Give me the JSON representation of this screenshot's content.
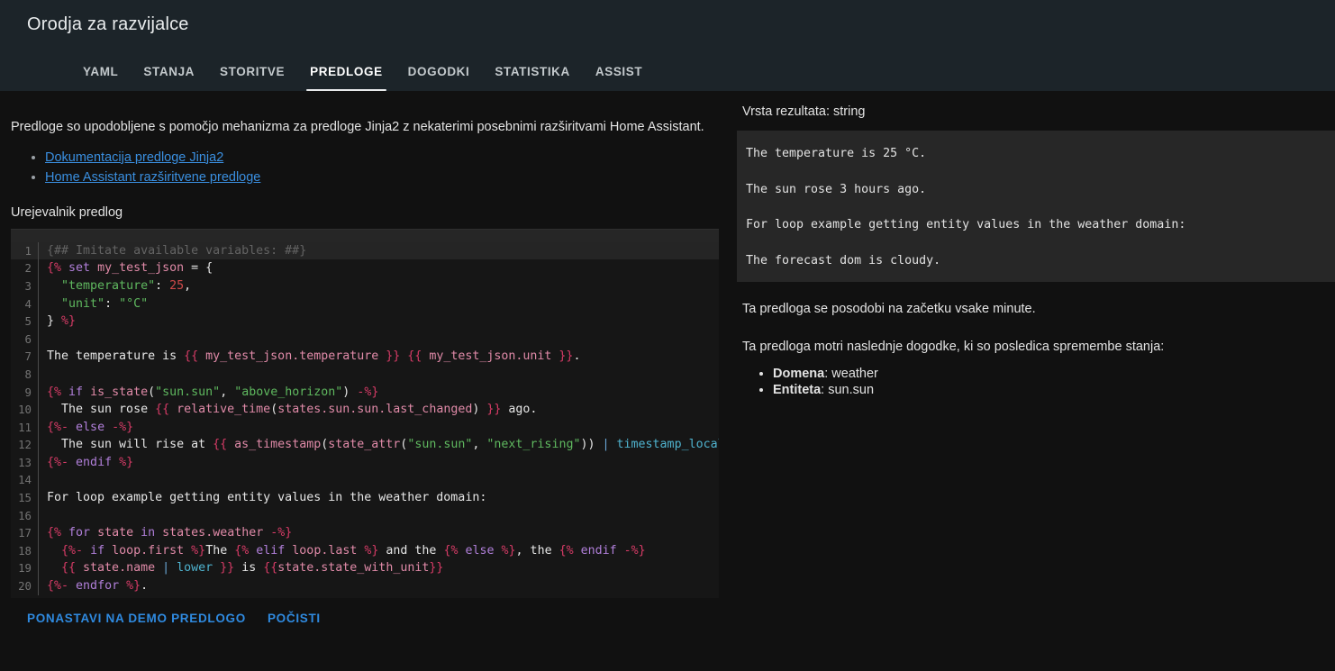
{
  "header": {
    "title": "Orodja za razvijalce",
    "tabs": [
      {
        "label": "YAML",
        "active": false
      },
      {
        "label": "STANJA",
        "active": false
      },
      {
        "label": "STORITVE",
        "active": false
      },
      {
        "label": "PREDLOGE",
        "active": true
      },
      {
        "label": "DOGODKI",
        "active": false
      },
      {
        "label": "STATISTIKA",
        "active": false
      },
      {
        "label": "ASSIST",
        "active": false
      }
    ]
  },
  "left": {
    "intro": "Predloge so upodobljene s pomočjo mehanizma za predloge Jinja2 z nekaterimi posebnimi razširitvami Home Assistant.",
    "links": [
      "Dokumentacija predloge Jinja2",
      "Home Assistant razširitvene predloge"
    ],
    "editor_label": "Urejevalnik predlog",
    "buttons": {
      "reset": "PONASTAVI NA DEMO PREDLOGO",
      "clear": "POČISTI"
    }
  },
  "editor": {
    "lines": [
      {
        "n": "1",
        "highlight": true,
        "tokens": [
          {
            "c": "t-comment",
            "t": "{## Imitate available variables: ##}"
          }
        ]
      },
      {
        "n": "2",
        "highlight": false,
        "tokens": [
          {
            "c": "t-delim",
            "t": "{%"
          },
          {
            "c": "t-plain",
            "t": " "
          },
          {
            "c": "t-kw",
            "t": "set"
          },
          {
            "c": "t-plain",
            "t": " "
          },
          {
            "c": "t-var",
            "t": "my_test_json"
          },
          {
            "c": "t-plain",
            "t": " = {"
          }
        ]
      },
      {
        "n": "3",
        "highlight": false,
        "tokens": [
          {
            "c": "t-plain",
            "t": "  "
          },
          {
            "c": "t-str",
            "t": "\"temperature\""
          },
          {
            "c": "t-plain",
            "t": ": "
          },
          {
            "c": "t-num",
            "t": "25"
          },
          {
            "c": "t-plain",
            "t": ","
          }
        ]
      },
      {
        "n": "4",
        "highlight": false,
        "tokens": [
          {
            "c": "t-plain",
            "t": "  "
          },
          {
            "c": "t-str",
            "t": "\"unit\""
          },
          {
            "c": "t-plain",
            "t": ": "
          },
          {
            "c": "t-str",
            "t": "\"°C\""
          }
        ]
      },
      {
        "n": "5",
        "highlight": false,
        "tokens": [
          {
            "c": "t-plain",
            "t": "} "
          },
          {
            "c": "t-delim",
            "t": "%}"
          }
        ]
      },
      {
        "n": "6",
        "highlight": false,
        "tokens": [
          {
            "c": "t-plain",
            "t": ""
          }
        ]
      },
      {
        "n": "7",
        "highlight": false,
        "tokens": [
          {
            "c": "t-plain",
            "t": "The temperature is "
          },
          {
            "c": "t-delim",
            "t": "{{"
          },
          {
            "c": "t-var",
            "t": " my_test_json.temperature "
          },
          {
            "c": "t-delim",
            "t": "}}"
          },
          {
            "c": "t-plain",
            "t": " "
          },
          {
            "c": "t-delim",
            "t": "{{"
          },
          {
            "c": "t-var",
            "t": " my_test_json.unit "
          },
          {
            "c": "t-delim",
            "t": "}}"
          },
          {
            "c": "t-plain",
            "t": "."
          }
        ]
      },
      {
        "n": "8",
        "highlight": false,
        "tokens": [
          {
            "c": "t-plain",
            "t": ""
          }
        ]
      },
      {
        "n": "9",
        "highlight": false,
        "tokens": [
          {
            "c": "t-delim",
            "t": "{%"
          },
          {
            "c": "t-plain",
            "t": " "
          },
          {
            "c": "t-kw",
            "t": "if"
          },
          {
            "c": "t-plain",
            "t": " "
          },
          {
            "c": "t-var",
            "t": "is_state"
          },
          {
            "c": "t-plain",
            "t": "("
          },
          {
            "c": "t-str",
            "t": "\"sun.sun\""
          },
          {
            "c": "t-plain",
            "t": ", "
          },
          {
            "c": "t-str",
            "t": "\"above_horizon\""
          },
          {
            "c": "t-plain",
            "t": ") "
          },
          {
            "c": "t-delim",
            "t": "-%}"
          }
        ]
      },
      {
        "n": "10",
        "highlight": false,
        "tokens": [
          {
            "c": "t-plain",
            "t": "  The sun rose "
          },
          {
            "c": "t-delim",
            "t": "{{"
          },
          {
            "c": "t-var",
            "t": " relative_time"
          },
          {
            "c": "t-plain",
            "t": "("
          },
          {
            "c": "t-var",
            "t": "states.sun.sun.last_changed"
          },
          {
            "c": "t-plain",
            "t": ") "
          },
          {
            "c": "t-delim",
            "t": "}}"
          },
          {
            "c": "t-plain",
            "t": " ago."
          }
        ]
      },
      {
        "n": "11",
        "highlight": false,
        "tokens": [
          {
            "c": "t-delim",
            "t": "{%-"
          },
          {
            "c": "t-plain",
            "t": " "
          },
          {
            "c": "t-kw",
            "t": "else"
          },
          {
            "c": "t-plain",
            "t": " "
          },
          {
            "c": "t-delim",
            "t": "-%}"
          }
        ]
      },
      {
        "n": "12",
        "highlight": false,
        "tokens": [
          {
            "c": "t-plain",
            "t": "  The sun will rise at "
          },
          {
            "c": "t-delim",
            "t": "{{"
          },
          {
            "c": "t-var",
            "t": " as_timestamp"
          },
          {
            "c": "t-plain",
            "t": "("
          },
          {
            "c": "t-var",
            "t": "state_attr"
          },
          {
            "c": "t-plain",
            "t": "("
          },
          {
            "c": "t-str",
            "t": "\"sun.sun\""
          },
          {
            "c": "t-plain",
            "t": ", "
          },
          {
            "c": "t-str",
            "t": "\"next_rising\""
          },
          {
            "c": "t-plain",
            "t": ")) "
          },
          {
            "c": "t-pipe",
            "t": "|"
          },
          {
            "c": "t-filter",
            "t": " timestamp_local "
          },
          {
            "c": "t-delim",
            "t": "}}"
          },
          {
            "c": "t-plain",
            "t": "."
          }
        ]
      },
      {
        "n": "13",
        "highlight": false,
        "tokens": [
          {
            "c": "t-delim",
            "t": "{%-"
          },
          {
            "c": "t-plain",
            "t": " "
          },
          {
            "c": "t-kw",
            "t": "endif"
          },
          {
            "c": "t-plain",
            "t": " "
          },
          {
            "c": "t-delim",
            "t": "%}"
          }
        ]
      },
      {
        "n": "14",
        "highlight": false,
        "tokens": [
          {
            "c": "t-plain",
            "t": ""
          }
        ]
      },
      {
        "n": "15",
        "highlight": false,
        "tokens": [
          {
            "c": "t-plain",
            "t": "For loop example getting entity values in the weather domain:"
          }
        ]
      },
      {
        "n": "16",
        "highlight": false,
        "tokens": [
          {
            "c": "t-plain",
            "t": ""
          }
        ]
      },
      {
        "n": "17",
        "highlight": false,
        "tokens": [
          {
            "c": "t-delim",
            "t": "{%"
          },
          {
            "c": "t-plain",
            "t": " "
          },
          {
            "c": "t-kw",
            "t": "for"
          },
          {
            "c": "t-plain",
            "t": " "
          },
          {
            "c": "t-var",
            "t": "state"
          },
          {
            "c": "t-plain",
            "t": " "
          },
          {
            "c": "t-kw",
            "t": "in"
          },
          {
            "c": "t-plain",
            "t": " "
          },
          {
            "c": "t-var",
            "t": "states.weather"
          },
          {
            "c": "t-plain",
            "t": " "
          },
          {
            "c": "t-delim",
            "t": "-%}"
          }
        ]
      },
      {
        "n": "18",
        "highlight": false,
        "tokens": [
          {
            "c": "t-plain",
            "t": "  "
          },
          {
            "c": "t-delim",
            "t": "{%-"
          },
          {
            "c": "t-plain",
            "t": " "
          },
          {
            "c": "t-kw",
            "t": "if"
          },
          {
            "c": "t-plain",
            "t": " "
          },
          {
            "c": "t-var",
            "t": "loop.first"
          },
          {
            "c": "t-plain",
            "t": " "
          },
          {
            "c": "t-delim",
            "t": "%}"
          },
          {
            "c": "t-plain",
            "t": "The "
          },
          {
            "c": "t-delim",
            "t": "{%"
          },
          {
            "c": "t-plain",
            "t": " "
          },
          {
            "c": "t-kw",
            "t": "elif"
          },
          {
            "c": "t-plain",
            "t": " "
          },
          {
            "c": "t-var",
            "t": "loop.last"
          },
          {
            "c": "t-plain",
            "t": " "
          },
          {
            "c": "t-delim",
            "t": "%}"
          },
          {
            "c": "t-plain",
            "t": " and the "
          },
          {
            "c": "t-delim",
            "t": "{%"
          },
          {
            "c": "t-plain",
            "t": " "
          },
          {
            "c": "t-kw",
            "t": "else"
          },
          {
            "c": "t-plain",
            "t": " "
          },
          {
            "c": "t-delim",
            "t": "%}"
          },
          {
            "c": "t-plain",
            "t": ", the "
          },
          {
            "c": "t-delim",
            "t": "{%"
          },
          {
            "c": "t-plain",
            "t": " "
          },
          {
            "c": "t-kw",
            "t": "endif"
          },
          {
            "c": "t-plain",
            "t": " "
          },
          {
            "c": "t-delim",
            "t": "-%}"
          }
        ]
      },
      {
        "n": "19",
        "highlight": false,
        "tokens": [
          {
            "c": "t-plain",
            "t": "  "
          },
          {
            "c": "t-delim",
            "t": "{{"
          },
          {
            "c": "t-var",
            "t": " state.name "
          },
          {
            "c": "t-pipe",
            "t": "|"
          },
          {
            "c": "t-filter",
            "t": " lower "
          },
          {
            "c": "t-delim",
            "t": "}}"
          },
          {
            "c": "t-plain",
            "t": " is "
          },
          {
            "c": "t-delim",
            "t": "{{"
          },
          {
            "c": "t-var",
            "t": "state.state_with_unit"
          },
          {
            "c": "t-delim",
            "t": "}}"
          }
        ]
      },
      {
        "n": "20",
        "highlight": false,
        "tokens": [
          {
            "c": "t-delim",
            "t": "{%-"
          },
          {
            "c": "t-plain",
            "t": " "
          },
          {
            "c": "t-kw",
            "t": "endfor"
          },
          {
            "c": "t-plain",
            "t": " "
          },
          {
            "c": "t-delim",
            "t": "%}"
          },
          {
            "c": "t-plain",
            "t": "."
          }
        ]
      }
    ]
  },
  "right": {
    "result_type_label": "Vrsta rezultata: string",
    "result_lines": [
      "The temperature is 25 °C.",
      "The sun rose 3 hours ago.",
      "For loop example getting entity values in the weather domain:",
      "The forecast dom is cloudy."
    ],
    "note_update": "Ta predloga se posodobi na začetku vsake minute.",
    "note_listen": "Ta predloga motri naslednje dogodke, ki so posledica spremembe stanja:",
    "meta": [
      {
        "key": "Domena",
        "value": "weather"
      },
      {
        "key": "Entiteta",
        "value": "sun.sun"
      }
    ]
  }
}
